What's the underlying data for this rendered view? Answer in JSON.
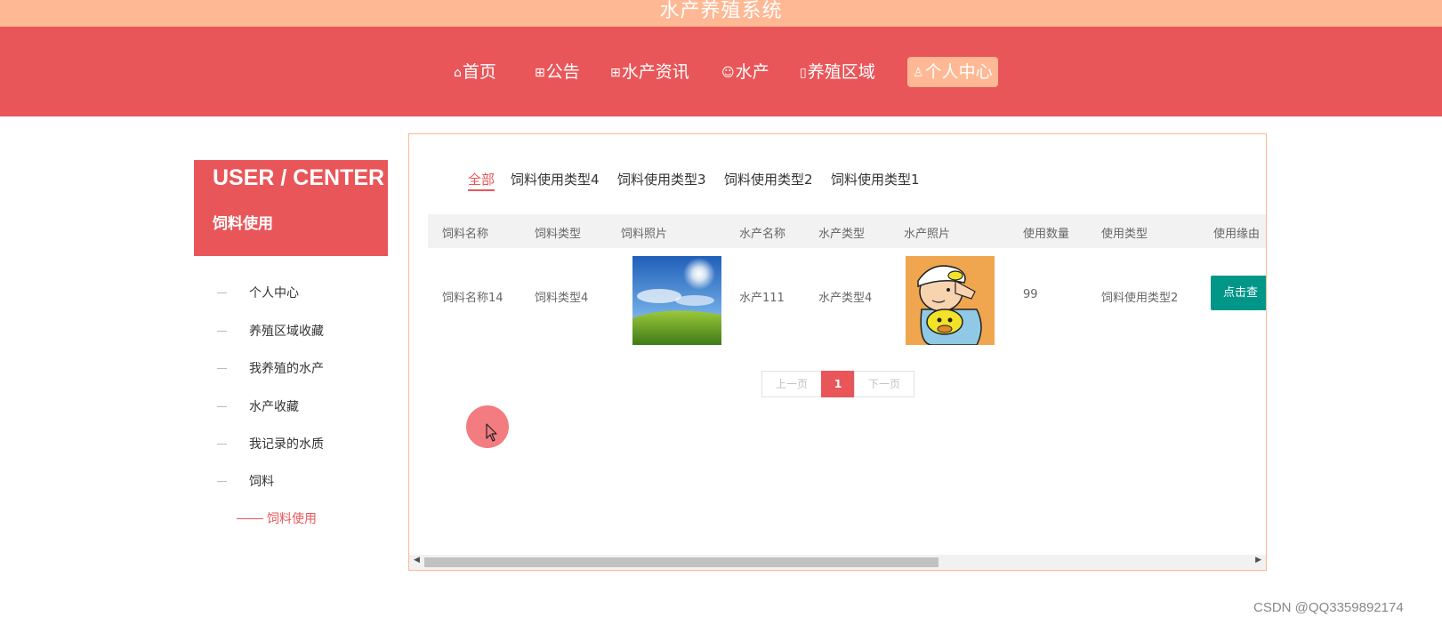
{
  "app": {
    "title": "水产养殖系统"
  },
  "nav": {
    "items": [
      {
        "label": "首页",
        "icon": "home-icon",
        "glyph": "⌂"
      },
      {
        "label": "公告",
        "icon": "gift-icon",
        "glyph": "⊞"
      },
      {
        "label": "水产资讯",
        "icon": "apps-icon",
        "glyph": "⊞"
      },
      {
        "label": "水产",
        "icon": "face-icon",
        "glyph": "☺"
      },
      {
        "label": "养殖区域",
        "icon": "columns-icon",
        "glyph": "▯"
      },
      {
        "label": "个人中心",
        "icon": "user-icon",
        "glyph": "♙",
        "active": true
      }
    ]
  },
  "sidebar": {
    "title": "USER / CENTER",
    "subtitle": "饲料使用",
    "items": [
      "个人中心",
      "养殖区域收藏",
      "我养殖的水产",
      "水产收藏",
      "我记录的水质",
      "饲料"
    ],
    "active_item": "饲料使用"
  },
  "tabs": [
    "全部",
    "饲料使用类型4",
    "饲料使用类型3",
    "饲料使用类型2",
    "饲料使用类型1"
  ],
  "table": {
    "headers": [
      "饲料名称",
      "饲料类型",
      "饲料照片",
      "水产名称",
      "水产类型",
      "水产照片",
      "使用数量",
      "使用类型",
      "使用缘由"
    ],
    "rows": [
      {
        "feed_name": "饲料名称14",
        "feed_type": "饲料类型4",
        "aquatic_name": "水产111",
        "aquatic_type": "水产类型4",
        "quantity": "99",
        "usage_type": "饲料使用类型2",
        "action": "点击查"
      }
    ]
  },
  "pagination": {
    "prev": "上一页",
    "current": "1",
    "next": "下一页"
  },
  "watermark": "CSDN @QQ3359892174",
  "colors": {
    "primary": "#e95659",
    "topbar": "#ffb894",
    "button": "#009688"
  }
}
